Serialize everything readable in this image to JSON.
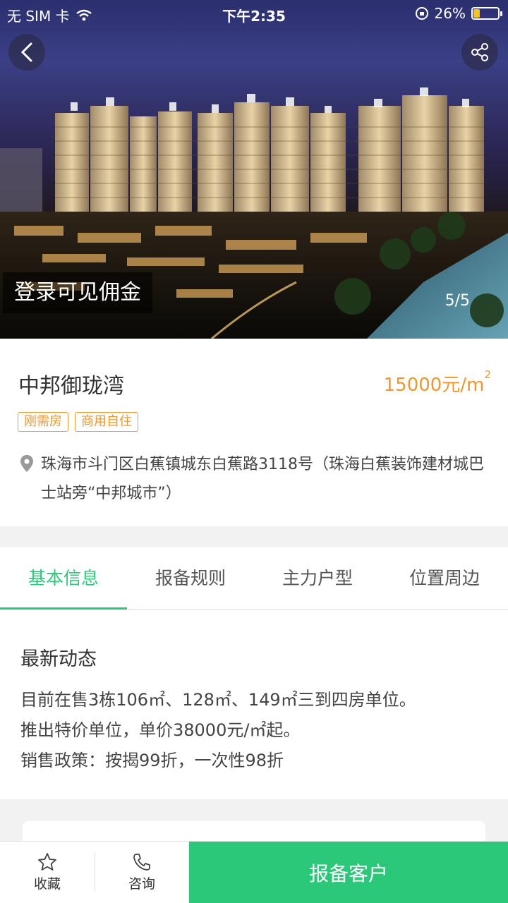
{
  "status_bar": {
    "carrier": "无 SIM 卡",
    "time": "下午2:35",
    "battery_percent": "26%",
    "battery_level": 0.26
  },
  "hero": {
    "commission_label": "登录可见佣金",
    "counter": "5/5"
  },
  "property": {
    "name": "中邦御珑湾",
    "price": "15000元/m",
    "price_superscript": "2",
    "tags": [
      "刚需房",
      "商用自住"
    ],
    "address": "珠海市斗门区白蕉镇城东白蕉路3118号（珠海白蕉装饰建材城巴士站旁“中邦城市”）"
  },
  "tabs": [
    {
      "label": "基本信息",
      "active": true
    },
    {
      "label": "报备规则",
      "active": false
    },
    {
      "label": "主力户型",
      "active": false
    },
    {
      "label": "位置周边",
      "active": false
    }
  ],
  "news": {
    "title": "最新动态",
    "lines": [
      "目前在售3栋106㎡、128㎡、149㎡三到四房单位。",
      "推出特价单位，单价38000元/㎡起。",
      "销售政策：按揭99折，一次性98折"
    ]
  },
  "bottom_bar": {
    "favorite_label": "收藏",
    "consult_label": "咨询",
    "report_label": "报备客户"
  },
  "colors": {
    "accent_green": "#2cc879",
    "price_orange": "#f0962d"
  }
}
